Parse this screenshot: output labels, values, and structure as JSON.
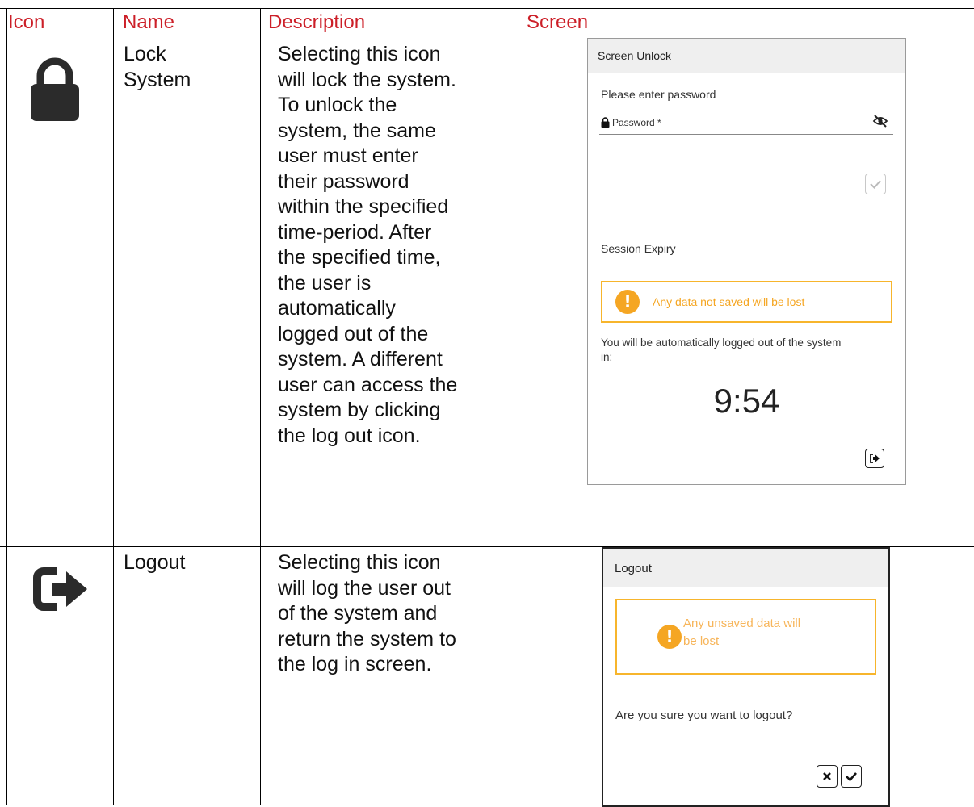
{
  "headers": {
    "icon": "Icon",
    "name": "Name",
    "description": "Description",
    "screen": "Screen"
  },
  "rows": [
    {
      "icon": "lock-icon",
      "name_lines": [
        "Lock",
        "System"
      ],
      "description_lines": [
        "Selecting this icon",
        "will lock the system.",
        "To unlock the",
        "system, the same",
        "user must enter",
        "their password",
        "within the specified",
        "time-period. After",
        "the specified time,",
        "the user is",
        "automatically",
        "logged out of the",
        "system. A different",
        "user can access the",
        "system by clicking",
        "the log out icon."
      ],
      "screen": {
        "title": "Screen Unlock",
        "prompt": "Please enter password",
        "password_label": "Password *",
        "section_title": "Session Expiry",
        "warning": "Any data not saved will be lost",
        "auto_logout_text_1": "You will be automatically logged out of the system",
        "auto_logout_text_2": "in:",
        "timer": "9:54"
      }
    },
    {
      "icon": "sign-out-icon",
      "name_lines": [
        "Logout"
      ],
      "description_lines": [
        "Selecting this icon",
        "will log the user out",
        "of the system and",
        "return the system to",
        "the log in screen."
      ],
      "screen": {
        "title": "Logout",
        "warning_line_1": "Any unsaved data will",
        "warning_line_2": "be lost",
        "question": "Are you sure you want to logout?"
      }
    }
  ],
  "colors": {
    "header_text": "#cc1f28",
    "warning": "#f5a623",
    "icon_dark": "#2b2b2b"
  }
}
